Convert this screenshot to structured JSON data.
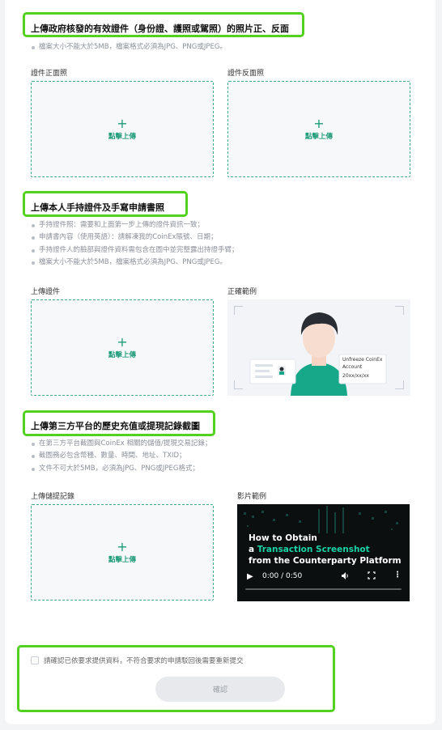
{
  "section1": {
    "title": "上傳政府核發的有效證件（身份證、護照或駕照）的照片正、反面",
    "bullets": [
      "檔案大小不能大於5MB，檔案格式必須為JPG、PNG或JPEG。"
    ],
    "front_label": "證件正面照",
    "back_label": "證件反面照",
    "upload_text": "點擊上傳"
  },
  "section2": {
    "title": "上傳本人手持證件及手寫申請書照",
    "bullets": [
      "手持證件照：需要和上面第一步上傳的證件資訊一致；",
      "申請書內容（使用英語）：請解凍我的CoinEx賬號、日期；",
      "手持證件人的臉部與證件資料需包含在圖中並完整露出持證手臂；",
      "檔案大小不能大於5MB，檔案格式必須為JPG、PNG或JPEG。"
    ],
    "upload_label": "上傳證件",
    "example_label": "正確範例",
    "upload_text": "點擊上傳",
    "note_line1": "Unfreeze CoinEx",
    "note_line2": "Account",
    "note_line3": "20xx/xx/xx"
  },
  "section3": {
    "title": "上傳第三方平台的歷史充值或提現記錄截圖",
    "bullets": [
      "在第三方平台截圖與CoinEx 相關的儲值/提現交易記錄；",
      "截圖務必包含幣種、數量、時間、地址、TXID；",
      "文件不可大於5MB，必須為JPG、PNG或JPEG格式；"
    ],
    "upload_label": "上傳儲提記錄",
    "video_label": "影片範例",
    "upload_text": "點擊上傳",
    "video": {
      "line1": "How to Obtain",
      "line2_prefix": "a ",
      "line2_highlight": "Transaction Screenshot",
      "line3": "from the Counterparty Platform",
      "time": "0:00 / 0:50"
    }
  },
  "confirm": {
    "checkbox_text": "請確認已依要求提供資料，不符合要求的申請駁回後需要重新提交",
    "button_label": "確認"
  },
  "colors": {
    "accent": "#1e9b78",
    "highlight_box": "#52d11e",
    "video_highlight": "#18d3a8"
  }
}
